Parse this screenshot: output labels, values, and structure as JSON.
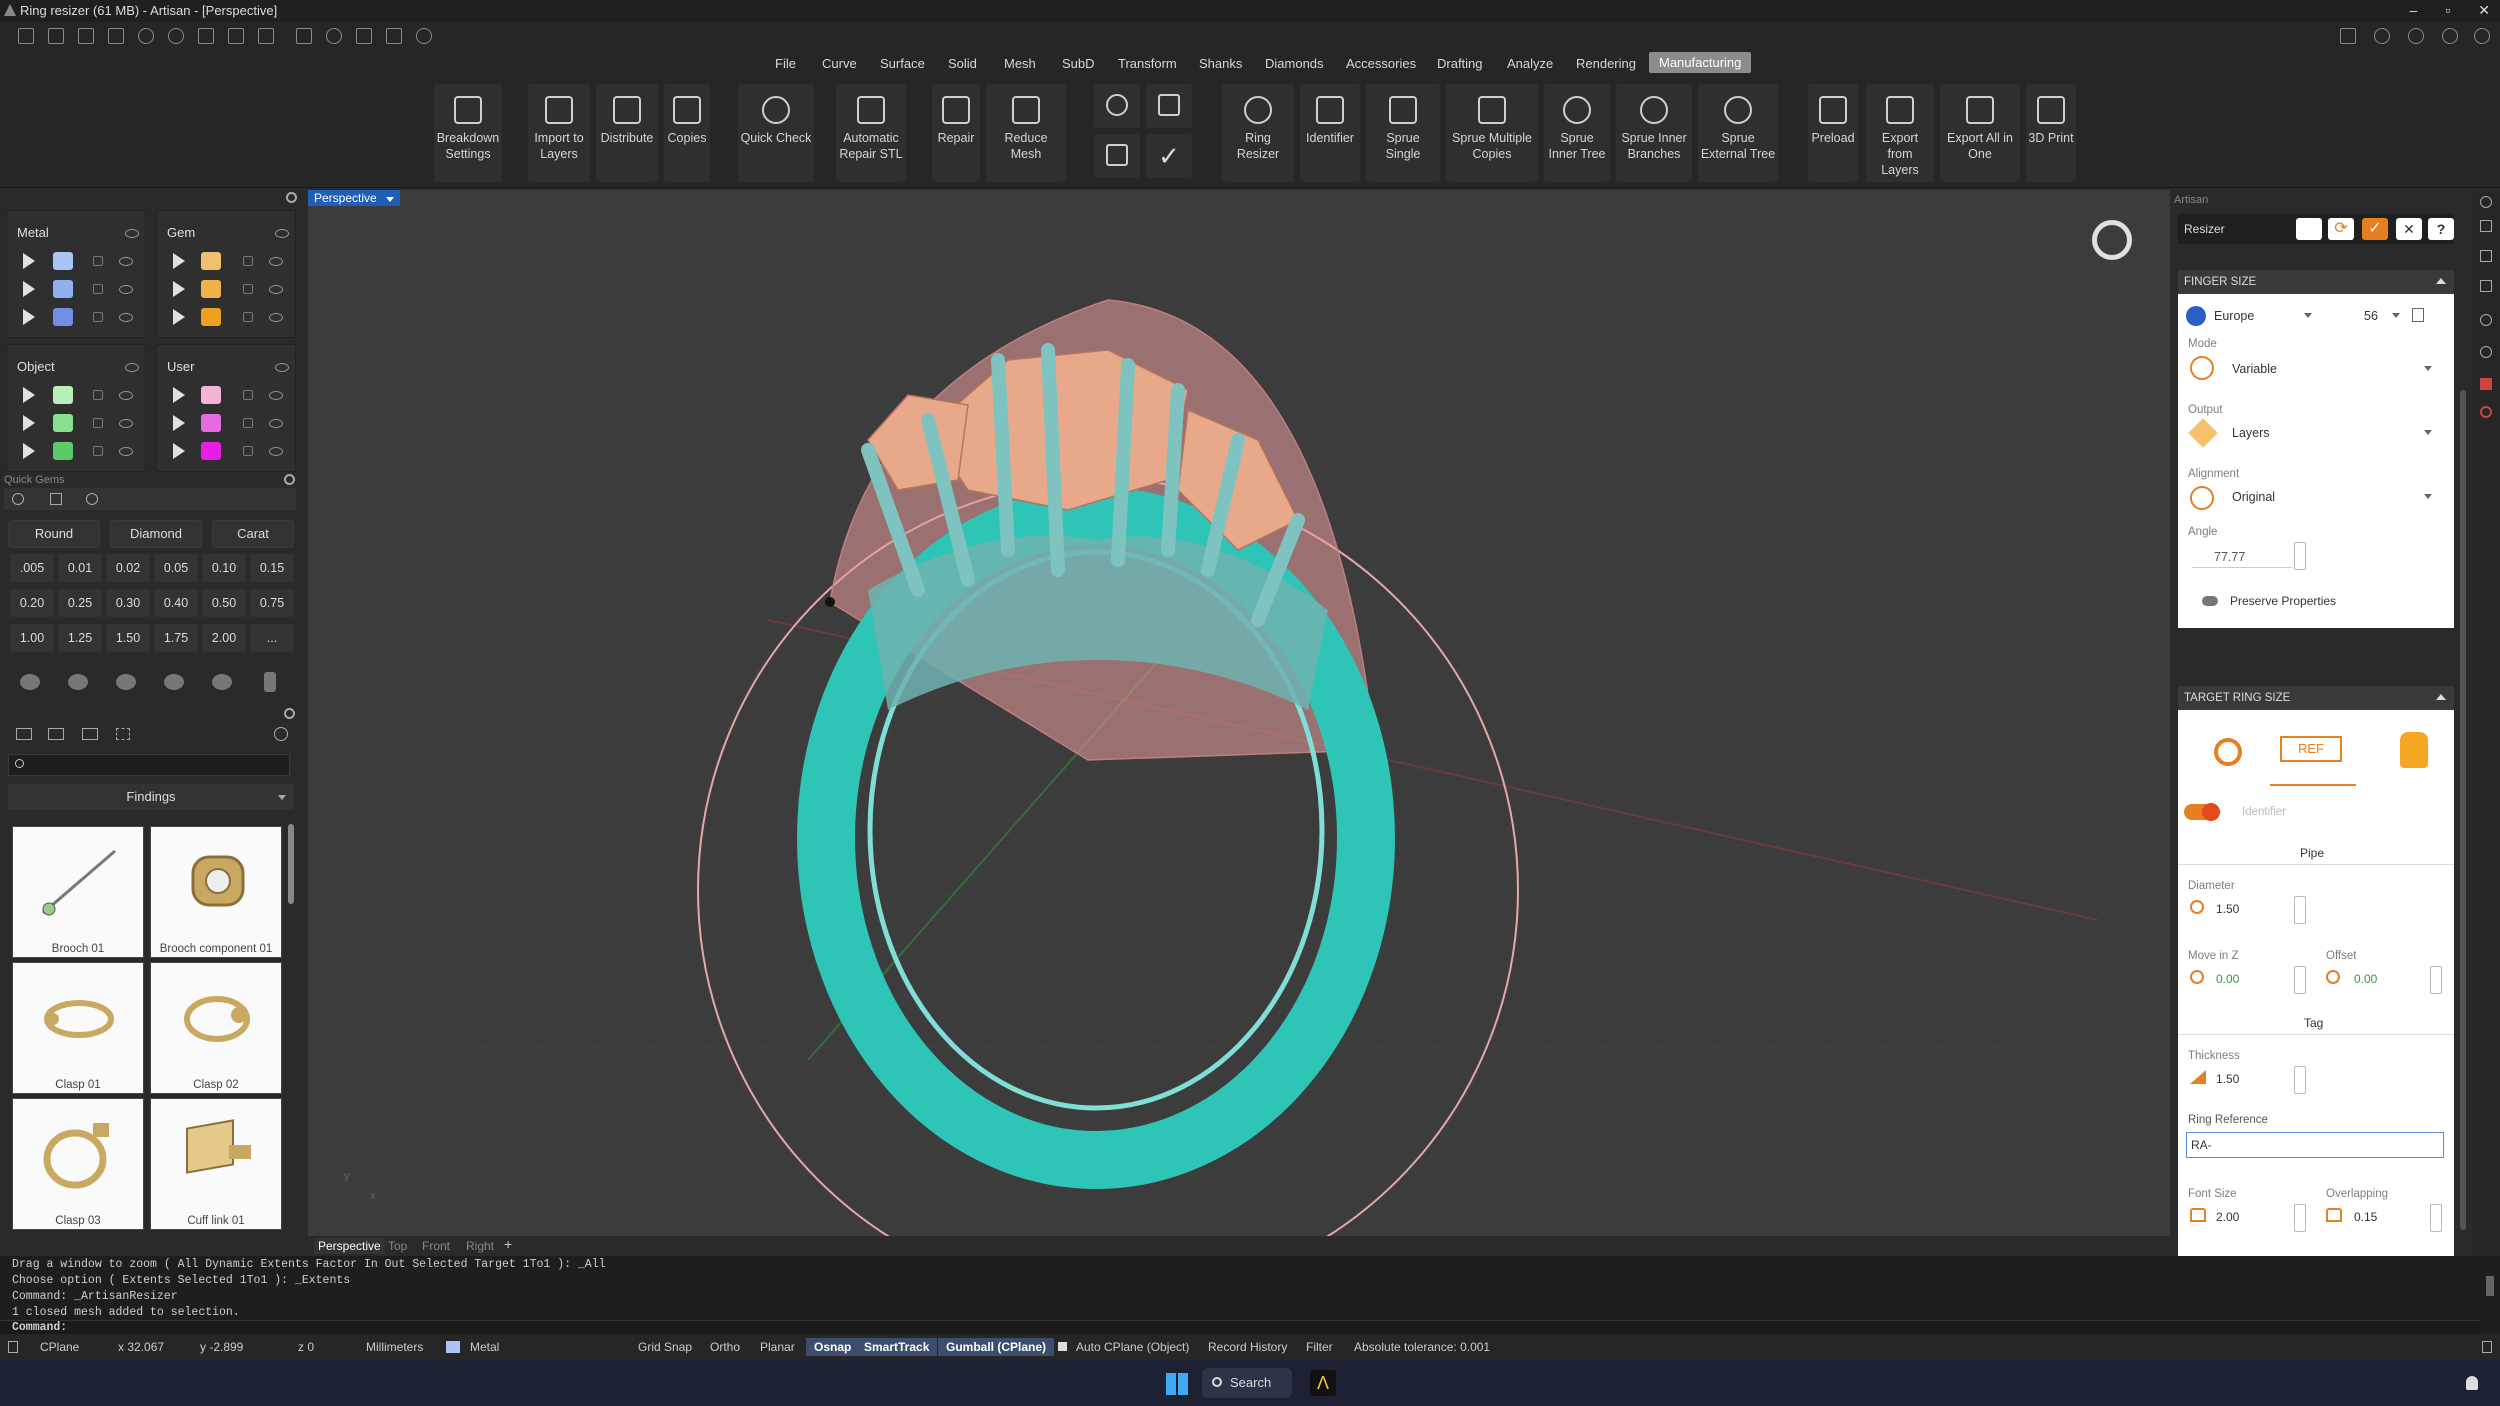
{
  "titlebar": {
    "title": "Ring resizer (61 MB) - Artisan - [Perspective]"
  },
  "menubar": {
    "items": [
      "File",
      "Curve",
      "Surface",
      "Solid",
      "Mesh",
      "SubD",
      "Transform",
      "Shanks",
      "Diamonds",
      "Accessories",
      "Drafting",
      "Analyze",
      "Rendering",
      "Manufacturing"
    ],
    "active": "Manufacturing"
  },
  "ribbon": {
    "buttons": [
      "Breakdown Settings",
      "Import to Layers",
      "Distribute",
      "Copies",
      "Quick Check",
      "Automatic Repair STL",
      "Repair",
      "Reduce Mesh",
      "Ring Resizer",
      "Identifier",
      "Sprue Single",
      "Sprue Multiple Copies",
      "Sprue Inner Tree",
      "Sprue Inner Branches",
      "Sprue External Tree",
      "Preload",
      "Export from Layers",
      "Export All in One",
      "3D Print"
    ]
  },
  "layers": {
    "metal": {
      "title": "Metal",
      "colors": [
        "#a9c4f5",
        "#8fb2ef",
        "#6f90e0"
      ]
    },
    "gem": {
      "title": "Gem",
      "colors": [
        "#f2c06a",
        "#f0b24a",
        "#f0a020"
      ]
    },
    "object": {
      "title": "Object",
      "colors": [
        "#b6f0b8",
        "#86e08e",
        "#5ec96a"
      ]
    },
    "user": {
      "title": "User",
      "colors": [
        "#f5b3d8",
        "#e66be0",
        "#e81ee8"
      ]
    }
  },
  "quick_gems": {
    "title": "Quick Gems",
    "shape": "Round",
    "stone": "Diamond",
    "unit": "Carat",
    "sizes": [
      ".005",
      "0.01",
      "0.02",
      "0.05",
      "0.10",
      "0.15",
      "0.20",
      "0.25",
      "0.30",
      "0.40",
      "0.50",
      "0.75",
      "1.00",
      "1.25",
      "1.50",
      "1.75",
      "2.00",
      "..."
    ]
  },
  "library": {
    "category": "Findings",
    "items": [
      "Brooch 01",
      "Brooch component 01",
      "Clasp 01",
      "Clasp 02",
      "Clasp 03",
      "Cuff link 01"
    ]
  },
  "viewport": {
    "label": "Perspective",
    "tabs": [
      "Perspective",
      "Top",
      "Front",
      "Right"
    ],
    "axis_labels": {
      "y": "y",
      "x": "x"
    }
  },
  "resizer": {
    "panel_title": "Artisan",
    "tool_name": "Resizer",
    "finger_size": {
      "title": "FINGER SIZE",
      "standard": "Europe",
      "size": "56",
      "mode_label": "Mode",
      "mode": "Variable",
      "output_label": "Output",
      "output": "Layers",
      "alignment_label": "Alignment",
      "alignment": "Original",
      "angle_label": "Angle",
      "angle": "77.77",
      "preserve": "Preserve Properties"
    },
    "target": {
      "title": "TARGET RING SIZE",
      "ref_icon_text": "REF",
      "identifier_label": "Identifier",
      "pipe_label": "Pipe",
      "diameter_label": "Diameter",
      "diameter": "1.50",
      "move_z_label": "Move in Z",
      "move_z": "0.00",
      "offset_label": "Offset",
      "offset": "0.00",
      "tag_label": "Tag",
      "thickness_label": "Thickness",
      "thickness": "1.50",
      "ring_ref_label": "Ring Reference",
      "ring_ref": "RA-",
      "font_size_label": "Font Size",
      "font_size": "2.00",
      "overlapping_label": "Overlapping",
      "overlapping": "0.15"
    }
  },
  "command": {
    "lines": [
      "Drag a window to zoom ( All  Dynamic  Extents  Factor  In  Out  Selected  Target  1To1 ): _All",
      "Choose option ( Extents  Selected  1To1 ): _Extents",
      "Command: _ArtisanResizer",
      "1 closed mesh added to selection."
    ],
    "prompt": "Command:"
  },
  "status": {
    "cplane": "CPlane",
    "x": "x 32.067",
    "y": "y -2.899",
    "z": "z 0",
    "units": "Millimeters",
    "layer": "Metal",
    "toggles": [
      "Grid Snap",
      "Ortho",
      "Planar",
      "Osnap",
      "SmartTrack",
      "Gumball (CPlane)"
    ],
    "active_toggles": [
      "Osnap",
      "SmartTrack",
      "Gumball (CPlane)"
    ],
    "auto_cplane": "Auto CPlane (Object)",
    "record": "Record History",
    "filter": "Filter",
    "tolerance": "Absolute tolerance: 0.001"
  },
  "taskbar": {
    "search": "Search"
  },
  "colors": {
    "accent": "#e67e22",
    "mesh_teal": "#2ec4b6",
    "gem_peach": "#e8a98a",
    "active_menu": "#8c8c8c"
  }
}
